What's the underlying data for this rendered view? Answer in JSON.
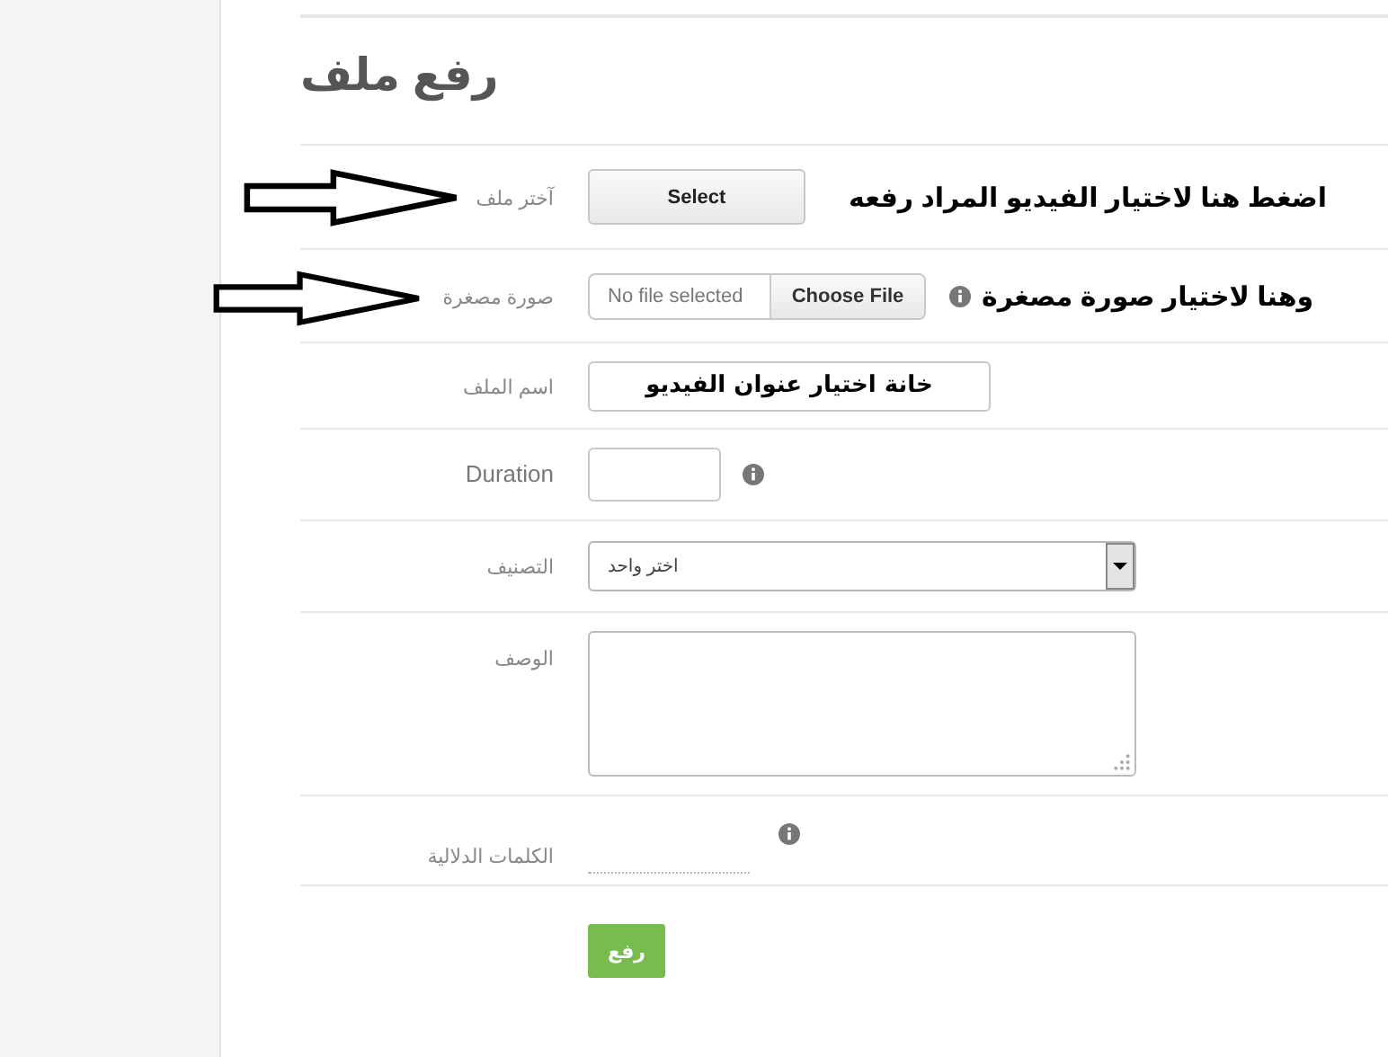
{
  "page": {
    "title": "رفع ملف"
  },
  "fields": [
    {
      "kind": "button",
      "label": "آختر ملف",
      "button": "Select",
      "info": false,
      "arrow": true,
      "note": "اضغط هنا لاختيار الفيديو المراد رفعه"
    },
    {
      "kind": "file",
      "label": "صورة مصغرة",
      "status": "No file selected",
      "button": "Choose File",
      "info": true,
      "arrow": true,
      "note": "وهنا لاختيار صورة مصغرة"
    },
    {
      "kind": "text",
      "label": "اسم الملف",
      "value": "خانة اختيار عنوان الفيديو",
      "info": false,
      "arrow": false
    },
    {
      "kind": "number",
      "label": "Duration",
      "info": true,
      "arrow": false
    },
    {
      "kind": "select",
      "label": "التصنيف",
      "value": "اختر واحد",
      "info": false,
      "arrow": false
    },
    {
      "kind": "textarea",
      "label": "الوصف",
      "info": false,
      "arrow": false
    },
    {
      "kind": "tags",
      "label": "الكلمات الدلالية",
      "info": true,
      "arrow": false
    }
  ],
  "submit": {
    "label": "رفع"
  }
}
